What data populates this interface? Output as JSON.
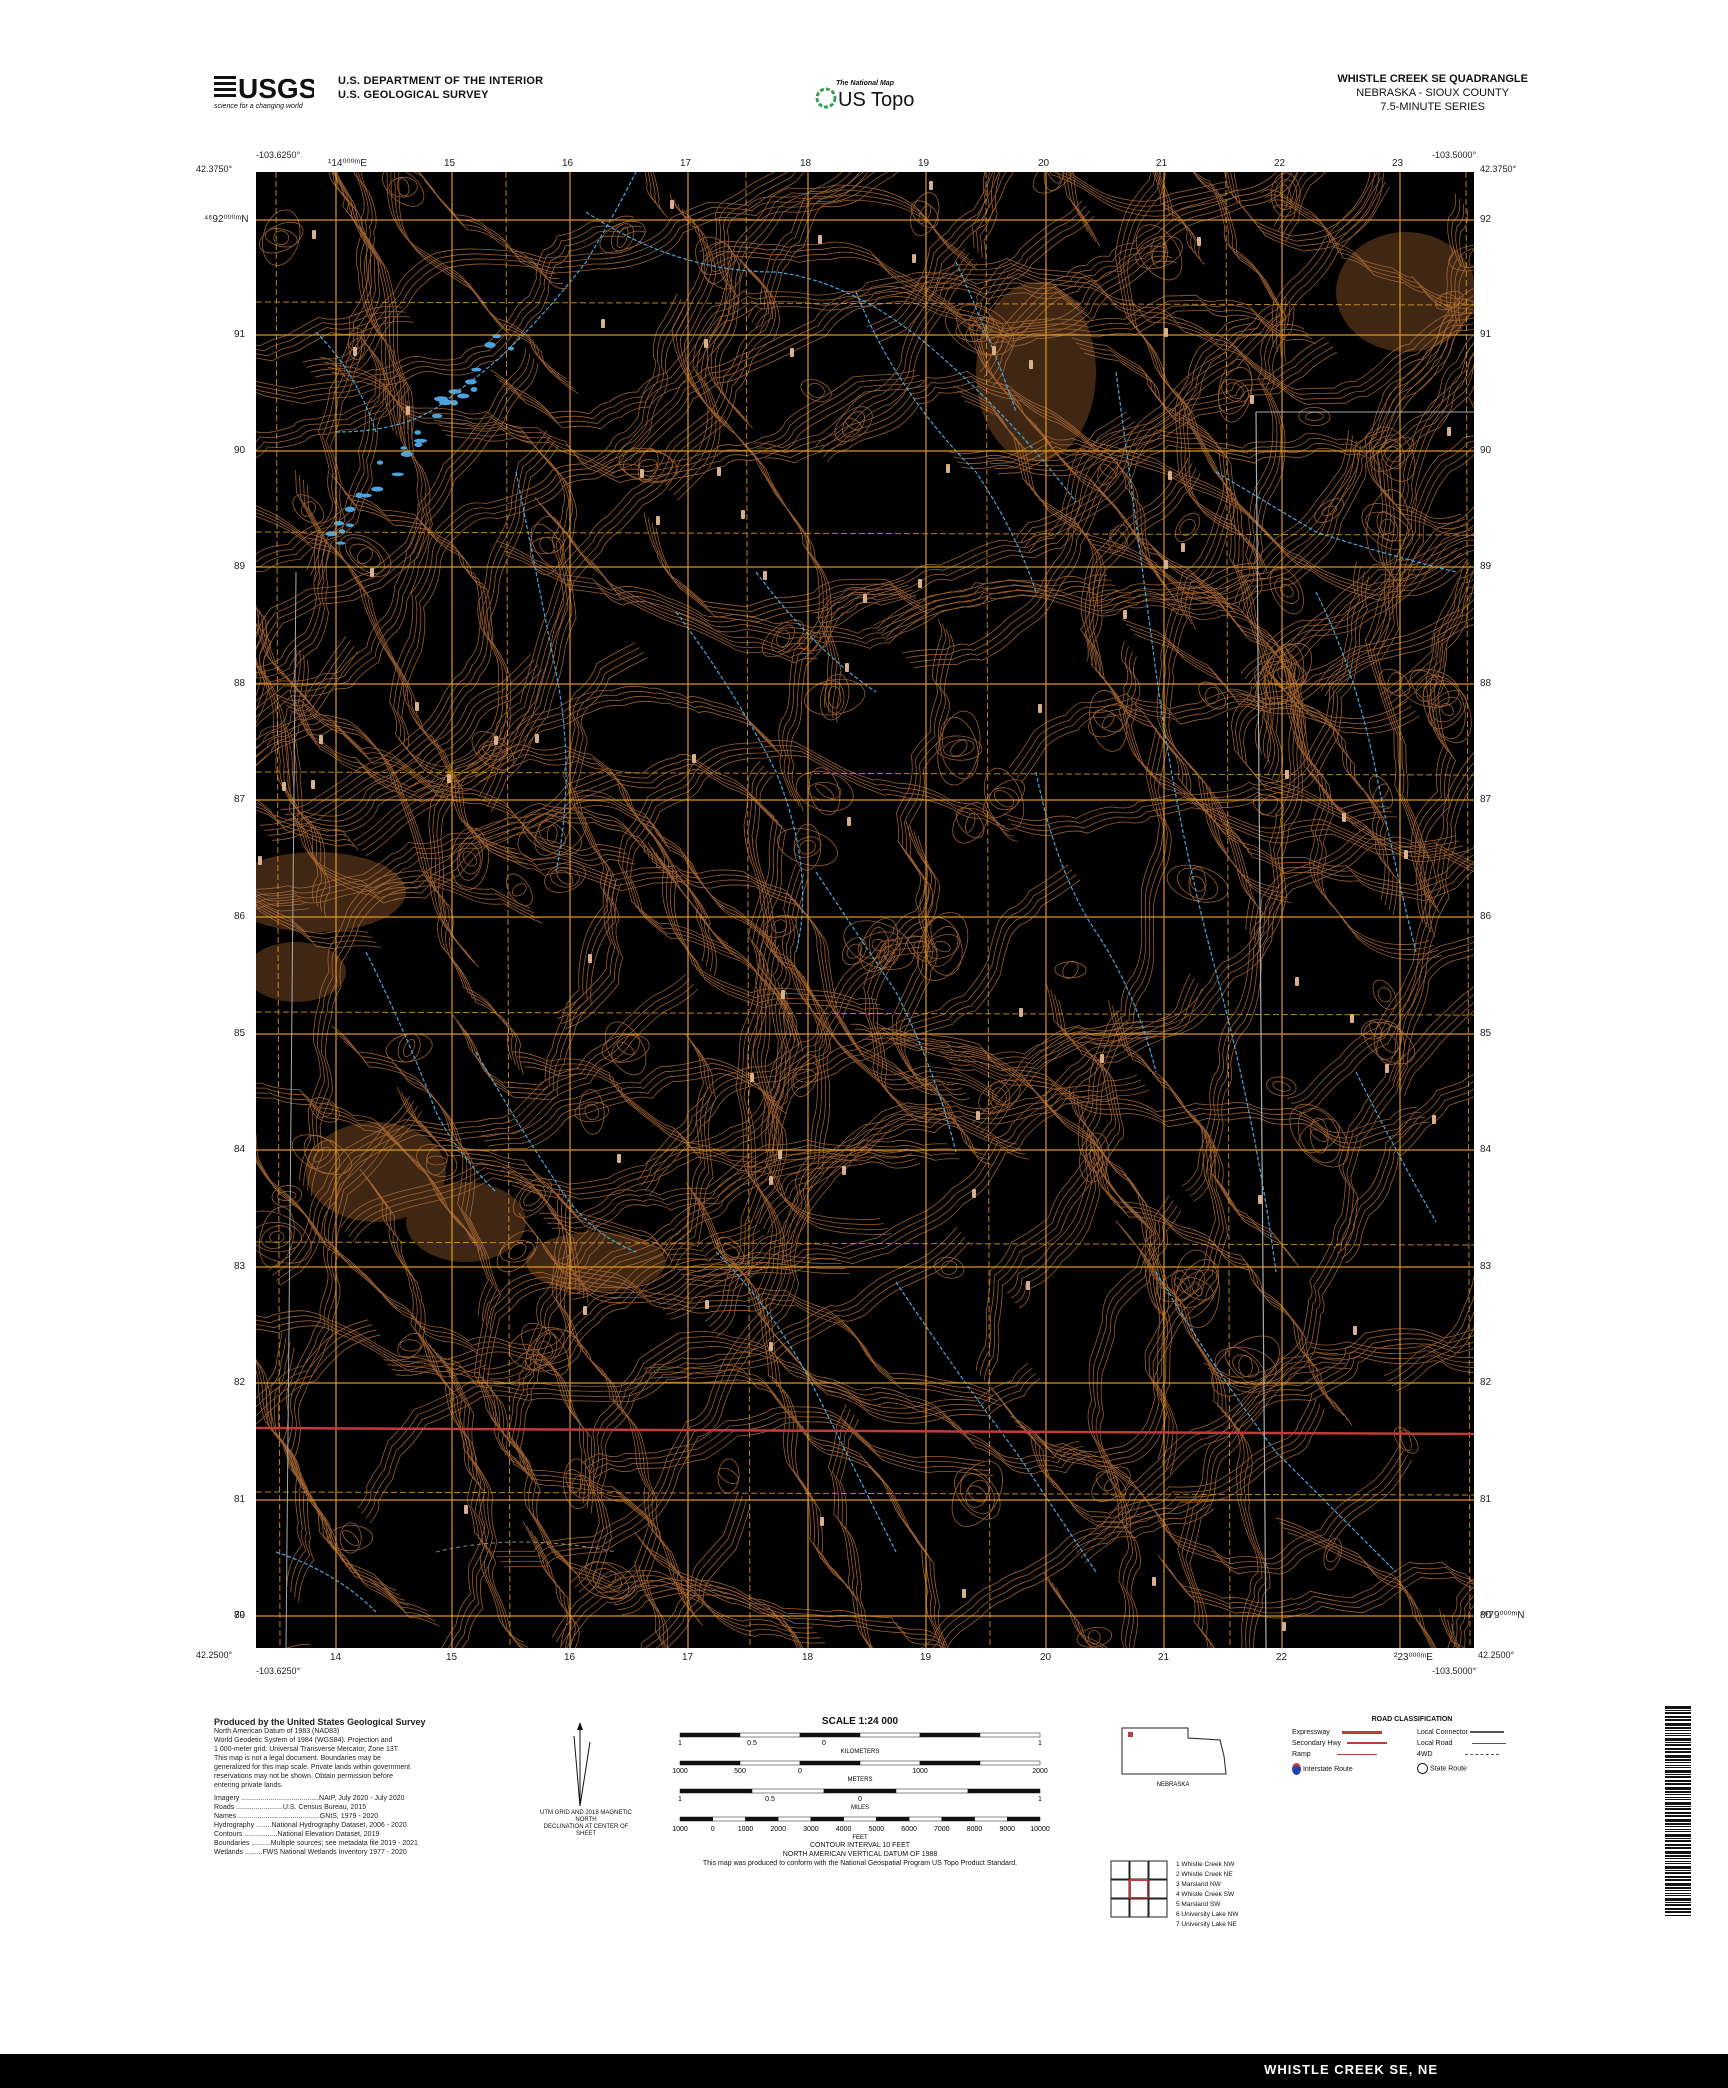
{
  "header": {
    "logo_text": "USGS",
    "logo_tagline": "science for a changing world",
    "dept_line1": "U.S. DEPARTMENT OF THE INTERIOR",
    "dept_line2": "U.S. GEOLOGICAL SURVEY",
    "national_map": "The National Map",
    "us_topo": "US Topo",
    "quad_title": "WHISTLE CREEK SE QUADRANGLE",
    "quad_state": "NEBRASKA - SIOUX COUNTY",
    "quad_series": "7.5-MINUTE SERIES"
  },
  "corners": {
    "tl_lat": "42.3750°",
    "tl_lon": "-103.6250°",
    "tr_lat": "42.3750°",
    "tr_lon": "-103.5000°",
    "bl_lat": "42.2500°",
    "bl_lon": "-103.6250°",
    "br_lat": "42.2500°",
    "br_lon": "-103.5000°"
  },
  "grid": {
    "top_ticks": [
      "¹14⁰⁰⁰ᵐE",
      "15",
      "16",
      "17",
      "18",
      "19",
      "20",
      "21",
      "22",
      "23"
    ],
    "bottom_ticks": [
      "14",
      "15",
      "16",
      "17",
      "18",
      "19",
      "20",
      "21",
      "22",
      "²23⁰⁰⁰ᵐE"
    ],
    "left_ticks": [
      "⁴⁶92⁰⁰⁰ᵐN",
      "91",
      "90",
      "89",
      "88",
      "87",
      "86",
      "85",
      "84",
      "83",
      "82",
      "81",
      "80",
      "79"
    ],
    "right_ticks": [
      "92",
      "91",
      "90",
      "89",
      "88",
      "87",
      "86",
      "85",
      "84",
      "83",
      "82",
      "81",
      "80",
      "⁴⁶79⁰⁰⁰ᵐN"
    ]
  },
  "colors": {
    "map_bg": "#000000",
    "contour": "#b5703a",
    "grid": "#e8a020",
    "water": "#4aa3df",
    "road": "#c23b3b"
  },
  "legend": {
    "produced_by": "Produced by the United States Geological Survey",
    "datum_lines": [
      "North American Datum of 1983 (NAD83)",
      "World Geodetic System of 1984 (WGS84). Projection and",
      "1 000-meter grid: Universal Transverse Mercator, Zone 13T",
      "This map is not a legal document. Boundaries may be",
      "generalized for this map scale. Private lands within government",
      "reservations may not be shown. Obtain permission before",
      "entering private lands."
    ],
    "sources": [
      "Imagery ........................................NAIP, July 2020 - July 2020",
      "Roads ........................U.S. Census Bureau, 2015",
      "Names ..........................................GNIS, 1979 - 2020",
      "Hydrography ........National Hydrography Dataset, 2006 - 2020",
      "Contours .................National Elevation Dataset, 2019",
      "Boundaries ..........Multiple sources; see metadata file 2019 - 2021",
      "Wetlands .........FWS National Wetlands Inventory 1977 - 2020"
    ],
    "scale_title": "SCALE 1:24 000",
    "scale_km_labels": [
      "1",
      "0.5",
      "0",
      "",
      "",
      "1"
    ],
    "scale_m_labels": [
      "1000",
      "500",
      "0",
      "",
      "1000",
      "",
      "2000"
    ],
    "scale_mi_labels": [
      "1",
      "0.5",
      "0",
      "",
      "1"
    ],
    "scale_ft_labels": [
      "1000",
      "0",
      "1000",
      "2000",
      "3000",
      "4000",
      "5000",
      "6000",
      "7000",
      "8000",
      "9000",
      "10000"
    ],
    "units": [
      "KILOMETERS",
      "METERS",
      "MILES",
      "FEET"
    ],
    "contour_note1": "CONTOUR INTERVAL 10 FEET",
    "contour_note2": "NORTH AMERICAN VERTICAL DATUM OF 1988",
    "standard_note": "This map was produced to conform with the National Geospatial Program US Topo Product Standard.",
    "declination": [
      "UTM GRID AND 2018 MAGNETIC NORTH",
      "DECLINATION AT CENTER OF SHEET"
    ],
    "state_label": "NEBRASKA",
    "road_class_title": "ROAD CLASSIFICATION",
    "road_left": [
      "Expressway",
      "Secondary Hwy",
      "Ramp",
      "Interstate Route"
    ],
    "road_right": [
      "Local Connector",
      "Local Road",
      "4WD",
      "State Route"
    ],
    "adjoining": [
      "1 Whistle Creek NW",
      "2 Whistle Creek NE",
      "3 Marsland NW",
      "4 Whistle Creek SW",
      "5 Marsland SW",
      "6 University Lake NW",
      "7 University Lake NE"
    ],
    "footer_title": "WHISTLE CREEK SE, NE",
    "ref_code": "2021"
  }
}
